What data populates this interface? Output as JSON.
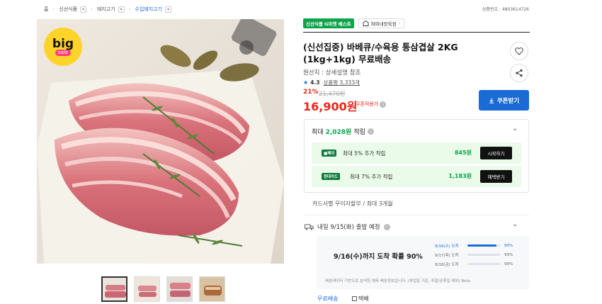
{
  "breadcrumb": {
    "home": "홈",
    "items": [
      "신선식품",
      "돼지고기",
      "수입돼지고기"
    ]
  },
  "product_number": "상품번호 : 4803614726",
  "gallery": {
    "badge_line1": "big",
    "badge_line2": "sale"
  },
  "badges": {
    "green": "신선식품 G마켓 베스트",
    "seller": "파파내장육점"
  },
  "product": {
    "title": "(신선집중) 바베큐/수육용 통삼겹살 2KG (1kg+1kg) 무료배송",
    "origin": "원산지 : 상세설명 참조",
    "rating": "4.3",
    "review_label": "상품평 3,333개",
    "discount_pct": "21%",
    "original_price": "21,470원",
    "price": "16,900원",
    "price_note": "쿠폰적용가"
  },
  "coupon_button": "쿠폰받기",
  "points": {
    "prefix": "최대",
    "amount": "2,028원",
    "suffix": "적립",
    "benefits": [
      {
        "logo": "■페이",
        "desc": "최대 5% 추가 적립",
        "amount": "845원",
        "button": "시작하기"
      },
      {
        "logo": "현대카드",
        "desc": "최대 7% 추가 적립",
        "amount": "1,183원",
        "button": "혜택받기"
      }
    ]
  },
  "installment": "카드사별 무이자할부 / 최대 3개월",
  "shipping": {
    "title": "내일 9/15(화) 출발 예정",
    "headline": "9/16(수)까지 도착 확률 90%",
    "rows": [
      {
        "date": "9/16(수) 도착",
        "percent": 90,
        "label": "90%"
      },
      {
        "date": "9/17(목) 도착",
        "percent": 99,
        "label": "99%"
      },
      {
        "date": "9/18(금) 도착",
        "percent": 99,
        "label": "99%"
      }
    ],
    "note": "배송데이터 기반으로 분석한 예측 배송정보입니다. (영업일 기준, 주말/공휴일 제외) Beta",
    "free_label": "무료배송",
    "type_label": "택배"
  },
  "colors": {
    "accent": "#1a6bd6",
    "price_red": "#e8271c",
    "points_green": "#0da34a"
  }
}
